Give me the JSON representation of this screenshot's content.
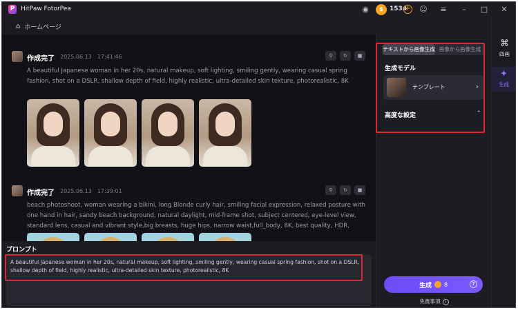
{
  "titlebar": {
    "app_title": "HitPaw FotorPea",
    "coin_count": "1534",
    "controls": {
      "gamepad": "gamepad-icon",
      "profile": "profile-icon",
      "menu": "menu-icon",
      "minimize": "minimize-icon",
      "maximize": "maximize-icon",
      "close": "close-icon"
    }
  },
  "breadcrumb": {
    "home_label": "ホームページ"
  },
  "generations": [
    {
      "status": "作成完了",
      "time": "2025.06.13　17:41:46",
      "prompt": "A beautiful Japanese woman in her 20s, natural makeup, soft lighting, smiling gently, wearing casual spring fashion, shot on a DSLR, shallow depth of field, highly realistic, ultra-detailed skin texture, photorealistic, 8K"
    },
    {
      "status": "作成完了",
      "time": "2025.06.13　17:39:01",
      "prompt": "beach photoshoot, woman wearing a bikini, long Blonde curly hair, smiling facial expression, relaxed posture with one hand in hair, sandy beach background, natural daylight, mid-frame shot, subject centered, eye-level view, standard lens, casual and vibrant style,big breasts, huge hips, narrow waist,full_body, 8K, best quality, HDR, highl..."
    }
  ],
  "prompt_panel": {
    "label": "プロンプト",
    "value": "A beautiful Japanese woman in her 20s, natural makeup, soft lighting, smiling gently, wearing casual spring fashion, shot on a DSLR, shallow depth of field, highly realistic, ultra-detailed skin texture, photorealistic, 8K"
  },
  "settings": {
    "tab_text_to_image": "テキストから画像生成",
    "tab_image_to_image": "画像から画像生成",
    "model_section": "生成モデル",
    "model_name": "テンプレート",
    "advanced_section": "高度な設定",
    "generate_label": "生成",
    "generate_cost": "8",
    "disclaimer": "免責事項"
  },
  "sidebar": {
    "items": [
      {
        "label": "四画",
        "icon": "grid-icon"
      },
      {
        "label": "生成",
        "icon": "sparkle-icon"
      }
    ]
  },
  "colors": {
    "accent": "#7a5cff",
    "highlight": "#e0262f",
    "coin": "#f4a525"
  }
}
